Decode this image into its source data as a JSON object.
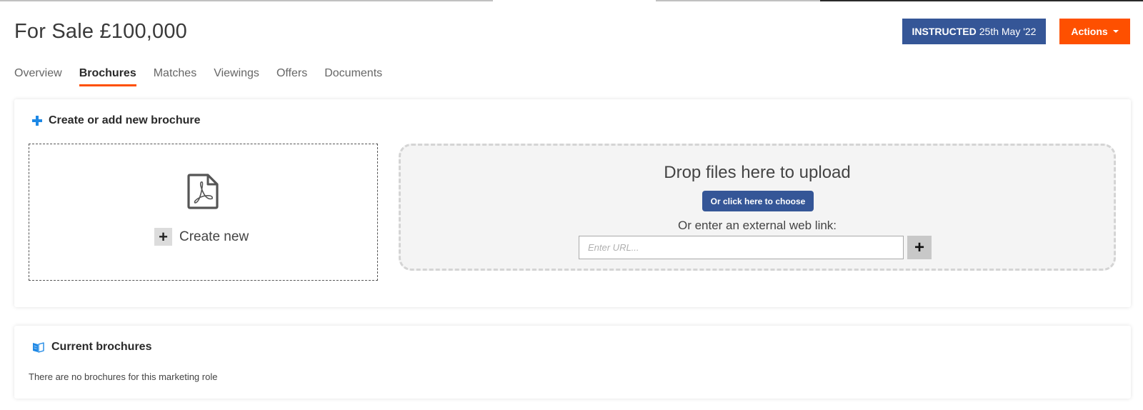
{
  "header": {
    "title": "For Sale £100,000",
    "status": {
      "label": "INSTRUCTED",
      "date": "25th May '22",
      "color": "#355697"
    },
    "actions_label": "Actions",
    "accent_color": "#fe5000"
  },
  "tabs": [
    {
      "label": "Overview",
      "active": false
    },
    {
      "label": "Brochures",
      "active": true
    },
    {
      "label": "Matches",
      "active": false
    },
    {
      "label": "Viewings",
      "active": false
    },
    {
      "label": "Offers",
      "active": false
    },
    {
      "label": "Documents",
      "active": false
    }
  ],
  "create_panel": {
    "heading": "Create or add new brochure",
    "heading_icon": "plus-icon",
    "create_new": {
      "icon": "pdf-file-icon",
      "label": "Create new"
    },
    "dropzone": {
      "title": "Drop files here to upload",
      "choose_button": "Or click here to choose",
      "link_label": "Or enter an external web link:",
      "url_placeholder": "Enter URL...",
      "url_value": "",
      "add_button": "+"
    }
  },
  "current_panel": {
    "heading": "Current brochures",
    "heading_icon": "brochure-icon",
    "empty_message": "There are no brochures for this marketing role"
  }
}
